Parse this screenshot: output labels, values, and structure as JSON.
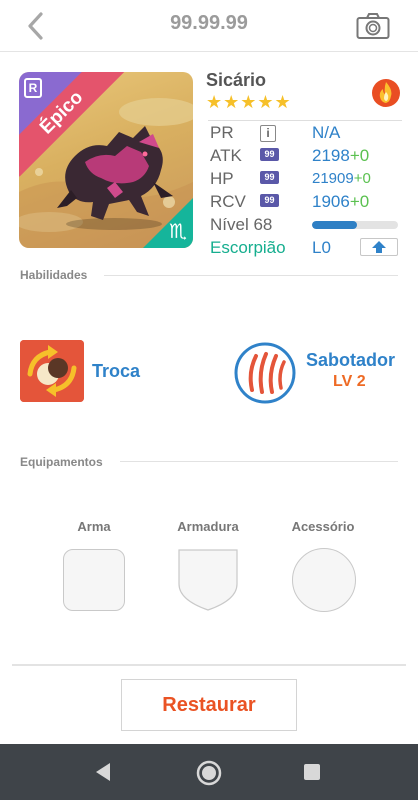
{
  "header": {
    "title": "99.99.99",
    "back_icon": "chevron-left-icon",
    "camera_icon": "camera-icon"
  },
  "monster": {
    "name": "Sicário",
    "rarity": "Épico",
    "stars": "★★★★★",
    "star_count": 5,
    "element_icon": "fire-icon",
    "zodiac_symbol": "♏",
    "rarity_badge": "R",
    "stats": {
      "pr_label": "PR",
      "pr_value": "N/A",
      "atk_label": "ATK",
      "atk_level": "99",
      "atk_value": "2198",
      "atk_bonus": "+0",
      "hp_label": "HP",
      "hp_level": "99",
      "hp_value": "21909",
      "hp_bonus": "+0",
      "rcv_label": "RCV",
      "rcv_level": "99",
      "rcv_value": "1906",
      "rcv_bonus": "+0",
      "level_label": "Nível 68",
      "level_progress": 0.52,
      "zodiac_label": "Escorpião",
      "limit_label": "L0"
    }
  },
  "skills": {
    "section_title": "Habilidades",
    "skill_name": "Troca",
    "leader_name": "Sabotador",
    "leader_level": "LV 2"
  },
  "equipment": {
    "section_title": "Equipamentos",
    "weapon_label": "Arma",
    "armor_label": "Armadura",
    "accessory_label": "Acessório"
  },
  "footer": {
    "restore_label": "Restaurar"
  },
  "colors": {
    "accent_blue": "#2f82c9",
    "restore_orange": "#ea5324",
    "epic_pink": "#e4546c",
    "zodiac_teal": "#16ae8f",
    "star_yellow": "#f6c02a"
  }
}
